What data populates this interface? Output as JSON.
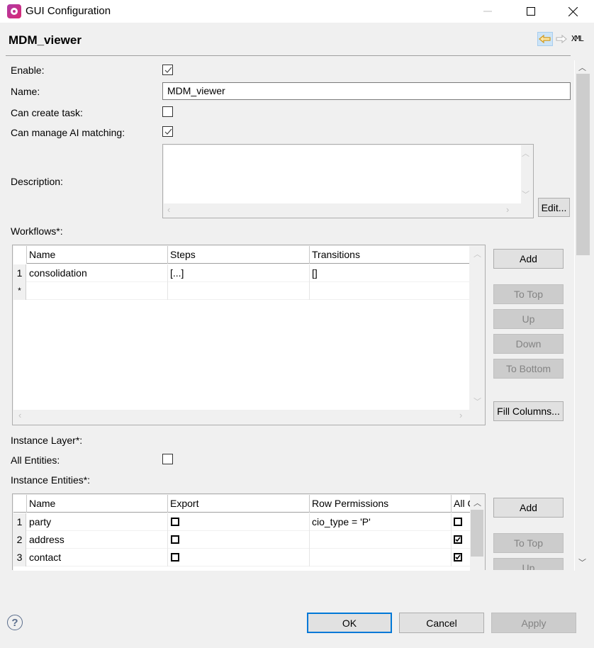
{
  "window": {
    "title": "GUI Configuration",
    "minimize_icon": "minimize-icon",
    "maximize_icon": "maximize-icon",
    "close_icon": "close-icon"
  },
  "header": {
    "title": "MDM_viewer",
    "back_icon": "arrow-left-icon",
    "forward_icon": "arrow-right-icon",
    "xml_label": "XML"
  },
  "form": {
    "enable": {
      "label": "Enable:",
      "checked": true
    },
    "name": {
      "label": "Name:",
      "value": "MDM_viewer"
    },
    "can_create_task": {
      "label": "Can create task:",
      "checked": false
    },
    "can_manage_ai": {
      "label": "Can manage AI matching:",
      "checked": true
    },
    "description": {
      "label": "Description:",
      "value": "",
      "edit_label": "Edit..."
    }
  },
  "workflows": {
    "label": "Workflows*:",
    "columns": [
      "Name",
      "Steps",
      "Transitions"
    ],
    "rows": [
      {
        "num": "1",
        "name": "consolidation",
        "steps": "[...]",
        "transitions": "[]"
      }
    ],
    "new_row_marker": "*",
    "buttons": {
      "add": "Add",
      "to_top": "To Top",
      "up": "Up",
      "down": "Down",
      "to_bottom": "To Bottom",
      "fill_columns": "Fill Columns..."
    }
  },
  "instance_layer": {
    "label": "Instance Layer*:",
    "all_entities": {
      "label": "All Entities:",
      "checked": false
    },
    "entities_label": "Instance Entities*:",
    "columns": [
      "Name",
      "Export",
      "Row Permissions",
      "All C"
    ],
    "rows": [
      {
        "num": "1",
        "name": "party",
        "export": false,
        "row_permissions": "cio_type = 'P'",
        "all_columns": false
      },
      {
        "num": "2",
        "name": "address",
        "export": false,
        "row_permissions": "",
        "all_columns": true
      },
      {
        "num": "3",
        "name": "contact",
        "export": false,
        "row_permissions": "",
        "all_columns": true
      }
    ],
    "buttons": {
      "add": "Add",
      "to_top": "To Top",
      "up": "Up"
    }
  },
  "footer": {
    "help_icon": "help-icon",
    "help_glyph": "?",
    "ok": "OK",
    "cancel": "Cancel",
    "apply": "Apply"
  }
}
